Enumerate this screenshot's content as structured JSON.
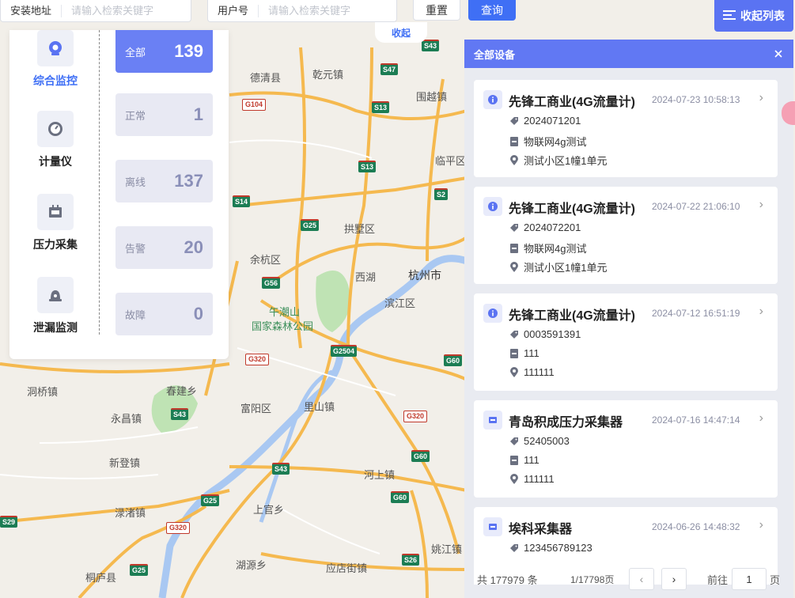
{
  "search": {
    "address_label": "安装地址",
    "address_placeholder": "请输入检索关键字",
    "user_label": "用户号",
    "user_placeholder": "请输入检索关键字",
    "reset_label": "重置",
    "query_label": "查询"
  },
  "map": {
    "collapse_label": "收起",
    "collapse_list_label": "收起列表",
    "places": [
      "德清县",
      "乾元镇",
      "围越镇",
      "临平区",
      "拱墅区",
      "余杭区",
      "西湖",
      "杭州市",
      "滨江区",
      "午潮山",
      "国家森林公园",
      "洞桥镇",
      "春建乡",
      "永昌镇",
      "富阳区",
      "里山镇",
      "新登镇",
      "河上镇",
      "渌渚镇",
      "上官乡",
      "桐庐县",
      "湖源乡",
      "应店街镇",
      "姚江镇"
    ],
    "shields": [
      "S43",
      "S47",
      "G104",
      "S13",
      "S13",
      "S14",
      "G25",
      "S2",
      "G56",
      "G2504",
      "G320",
      "G60",
      "S43",
      "G320",
      "G60",
      "S43",
      "G25",
      "G60",
      "G320",
      "S29",
      "G25",
      "S26"
    ]
  },
  "left_panel": {
    "categories": [
      {
        "name": "综合监控",
        "icon": "monitor-icon"
      },
      {
        "name": "计量仪",
        "icon": "gauge-icon"
      },
      {
        "name": "压力采集",
        "icon": "pressure-icon"
      },
      {
        "name": "泄漏监测",
        "icon": "alarm-icon"
      }
    ],
    "stats": [
      {
        "label": "全部",
        "value": "139"
      },
      {
        "label": "正常",
        "value": "1"
      },
      {
        "label": "离线",
        "value": "137"
      },
      {
        "label": "告警",
        "value": "20"
      },
      {
        "label": "故障",
        "value": "0"
      }
    ]
  },
  "device_list": {
    "title": "全部设备",
    "items": [
      {
        "name": "先锋工商业(4G流量计)",
        "date": "2024-07-23 10:58:13",
        "code": "2024071201",
        "type": "物联网4g测试",
        "address": "测试小区1幢1单元",
        "icon": "info-icon"
      },
      {
        "name": "先锋工商业(4G流量计)",
        "date": "2024-07-22 21:06:10",
        "code": "2024072201",
        "type": "物联网4g测试",
        "address": "测试小区1幢1单元",
        "icon": "info-icon"
      },
      {
        "name": "先锋工商业(4G流量计)",
        "date": "2024-07-12 16:51:19",
        "code": "0003591391",
        "type": "111",
        "address": "111111",
        "icon": "info-icon"
      },
      {
        "name": "青岛积成压力采集器",
        "date": "2024-07-16 14:47:14",
        "code": "52405003",
        "type": "111",
        "address": "111111",
        "icon": "collector-icon"
      },
      {
        "name": "埃科采集器",
        "date": "2024-06-26 14:48:32",
        "code": "123456789123",
        "type": "",
        "address": "",
        "icon": "collector-icon"
      }
    ],
    "pager": {
      "total": "共 177979 条",
      "page": "1/17798页",
      "goto_label": "前往",
      "goto_value": "1",
      "page_unit": "页"
    }
  }
}
